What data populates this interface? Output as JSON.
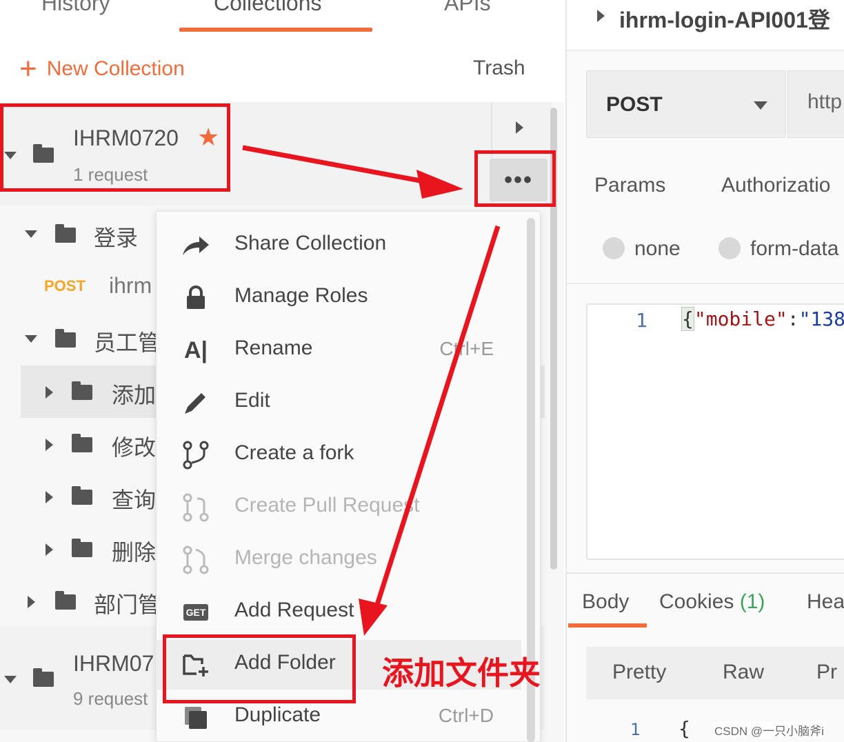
{
  "tabs": {
    "history": "History",
    "collections": "Collections",
    "apis": "APIs"
  },
  "toolbar": {
    "new_collection": "New Collection",
    "trash": "Trash"
  },
  "collection": {
    "name": "IHRM0720",
    "count": "1 request"
  },
  "tree": {
    "login_folder": "登录",
    "post_method": "POST",
    "post_name": "ihrm",
    "emp_folder": "员工管",
    "add_folder": "添加",
    "edit_folder": "修改",
    "query_folder": "查询",
    "delete_folder": "删除",
    "dept_folder": "部门管"
  },
  "collection2": {
    "name": "IHRM07",
    "count": "9 request"
  },
  "more_button": "•••",
  "menu": {
    "share": "Share Collection",
    "roles": "Manage Roles",
    "rename": "Rename",
    "rename_shortcut": "Ctrl+E",
    "edit": "Edit",
    "fork": "Create a fork",
    "pull": "Create Pull Request",
    "merge": "Merge changes",
    "add_request": "Add Request",
    "get_badge": "GET",
    "add_folder": "Add Folder",
    "duplicate": "Duplicate",
    "duplicate_shortcut": "Ctrl+D"
  },
  "annotation": "添加文件夹",
  "request": {
    "title": "ihrm-login-API001登",
    "method": "POST",
    "url": "http",
    "tabs": {
      "params": "Params",
      "auth": "Authorizatio"
    },
    "body_types": {
      "none": "none",
      "form_data": "form-data"
    },
    "line_no": "1",
    "code_key": "\"mobile\"",
    "code_colon": ":",
    "code_value": "\"138"
  },
  "response": {
    "tabs": {
      "body": "Body",
      "cookies": "Cookies",
      "cookies_count": "(1)",
      "headers": "Hea"
    },
    "formats": {
      "pretty": "Pretty",
      "raw": "Raw",
      "preview": "Pr"
    },
    "line_no": "1",
    "brace": "{"
  },
  "watermark": "CSDN @一只小脑斧i",
  "colors": {
    "accent": "#f26b3a",
    "annotation": "#e8141e",
    "post": "#f5a623"
  }
}
